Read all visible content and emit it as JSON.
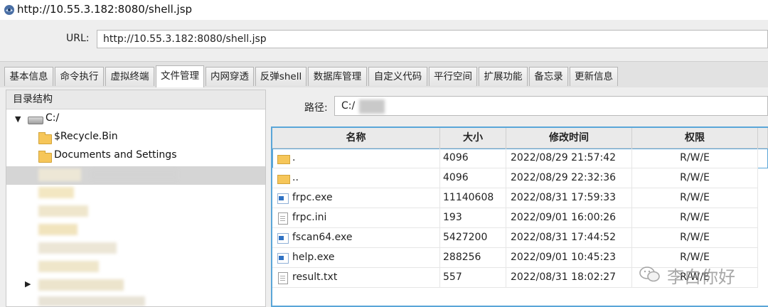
{
  "window": {
    "title": "http://10.55.3.182:8080/shell.jsp"
  },
  "url_bar": {
    "label": "URL:",
    "value": "http://10.55.3.182:8080/shell.jsp"
  },
  "tabs": [
    {
      "label": "基本信息"
    },
    {
      "label": "命令执行"
    },
    {
      "label": "虚拟终端"
    },
    {
      "label": "文件管理",
      "active": true
    },
    {
      "label": "内网穿透"
    },
    {
      "label": "反弹shell"
    },
    {
      "label": "数据库管理"
    },
    {
      "label": "自定义代码"
    },
    {
      "label": "平行空间"
    },
    {
      "label": "扩展功能"
    },
    {
      "label": "备忘录"
    },
    {
      "label": "更新信息"
    }
  ],
  "tree": {
    "header": "目录结构",
    "drive": "C:/",
    "items": [
      {
        "label": "$Recycle.Bin"
      },
      {
        "label": "Documents and Settings"
      }
    ]
  },
  "path_bar": {
    "label": "路径:",
    "value": "C:/"
  },
  "file_table": {
    "columns": [
      "名称",
      "大小",
      "修改时间",
      "权限"
    ],
    "rows": [
      {
        "icon": "folder-icon",
        "name": ".",
        "size": "4096",
        "modified": "2022/08/29 21:57:42",
        "perm": "R/W/E"
      },
      {
        "icon": "folder-icon",
        "name": "..",
        "size": "4096",
        "modified": "2022/08/29 22:32:36",
        "perm": "R/W/E"
      },
      {
        "icon": "exe-icon",
        "name": "frpc.exe",
        "size": "11140608",
        "modified": "2022/08/31 17:59:33",
        "perm": "R/W/E"
      },
      {
        "icon": "ini-file-icon",
        "name": "frpc.ini",
        "size": "193",
        "modified": "2022/09/01 16:00:26",
        "perm": "R/W/E"
      },
      {
        "icon": "exe-icon",
        "name": "fscan64.exe",
        "size": "5427200",
        "modified": "2022/08/31 17:44:52",
        "perm": "R/W/E"
      },
      {
        "icon": "exe-icon",
        "name": "help.exe",
        "size": "288256",
        "modified": "2022/09/01 10:45:23",
        "perm": "R/W/E"
      },
      {
        "icon": "text-file-icon",
        "name": "result.txt",
        "size": "557",
        "modified": "2022/08/31 18:02:27",
        "perm": "R/W/E"
      }
    ]
  },
  "watermark": {
    "text": "李白你好"
  },
  "colors": {
    "accent": "#5aa6d8",
    "folder": "#f6c659",
    "exe": "#2f72c4"
  }
}
